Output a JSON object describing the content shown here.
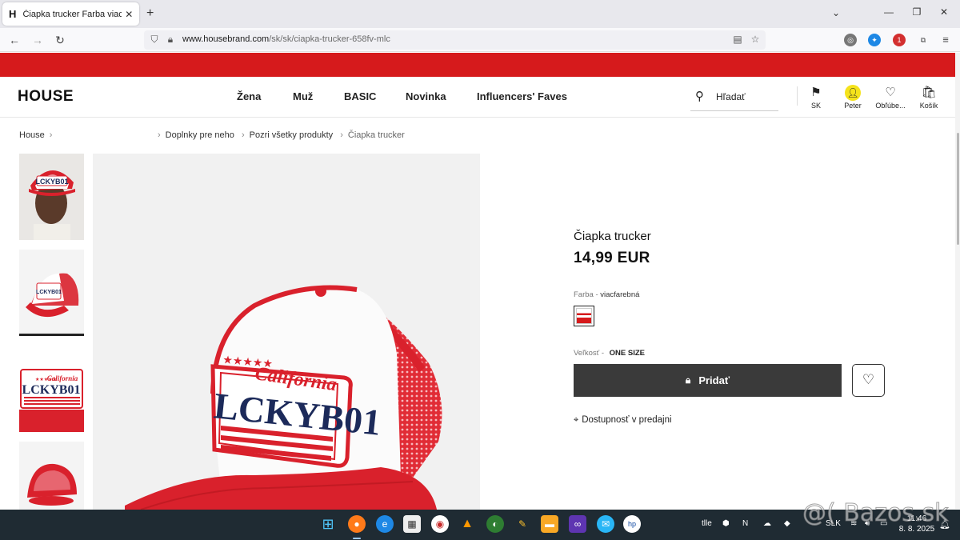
{
  "browser": {
    "tab_title": "Čiapka trucker Farba viacfarebná",
    "favicon": "H",
    "url_host": "www.housebrand.com",
    "url_path": "/sk/sk/ciapka-trucker-658fv-mlc",
    "ext_badge": "1"
  },
  "header": {
    "logo": "HOUSE",
    "nav": [
      "Žena",
      "Muž",
      "BASIC",
      "Novinka",
      "Influencers' Faves"
    ],
    "search_placeholder": "Hľadať",
    "country": "SK",
    "account": "Peter",
    "favorites": "Obľúbe...",
    "cart": "Košík"
  },
  "breadcrumbs": {
    "home": "House",
    "items": [
      "Doplnky pre neho",
      "Pozri všetky produkty",
      "Čiapka trucker"
    ]
  },
  "product": {
    "name": "Čiapka trucker",
    "price": "14,99 EUR",
    "color_label": "Farba - ",
    "color_value": "viacfarebná",
    "size_label": "Veľkosť - ",
    "size_value": "ONE SIZE",
    "add_label": "Pridať",
    "availability": "Dostupnosť v predajni",
    "cap_text": "LCKYB01",
    "cap_script": "California",
    "cap_stars": "★★★★★"
  },
  "taskbar": {
    "tray_text": "tlle",
    "lang": "SLK",
    "time": "11:46",
    "date": "8. 8. 2025"
  },
  "watermark": "@( Bazos.sk",
  "colors": {
    "promo": "#d61a1c",
    "button": "#3a3a3a",
    "accent_cap_red": "#d9212c",
    "cap_navy": "#1c2a5a"
  }
}
